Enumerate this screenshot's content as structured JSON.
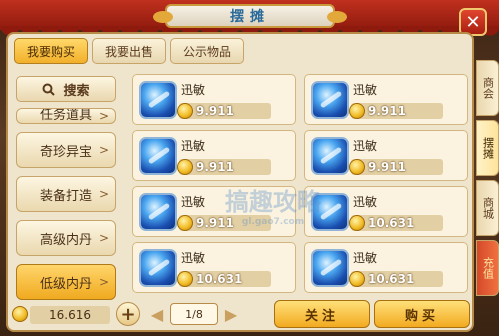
{
  "header": {
    "title": "摆摊",
    "close_label": "✕"
  },
  "tabs": [
    {
      "label": "我要购买",
      "active": true
    },
    {
      "label": "我要出售",
      "active": false
    },
    {
      "label": "公示物品",
      "active": false
    }
  ],
  "search": {
    "label": "搜索"
  },
  "categories": [
    {
      "label": "任务道具",
      "partial": true
    },
    {
      "label": "奇珍异宝"
    },
    {
      "label": "装备打造"
    },
    {
      "label": "高级内丹"
    },
    {
      "label": "低级内丹",
      "active": true
    }
  ],
  "items": [
    {
      "name": "迅敏",
      "price": "9.911"
    },
    {
      "name": "迅敏",
      "price": "9.911"
    },
    {
      "name": "迅敏",
      "price": "9.911"
    },
    {
      "name": "迅敏",
      "price": "9.911"
    },
    {
      "name": "迅敏",
      "price": "9.911"
    },
    {
      "name": "迅敏",
      "price": "10.631"
    },
    {
      "name": "迅敏",
      "price": "10.631"
    },
    {
      "name": "迅敏",
      "price": "10.631"
    }
  ],
  "footer": {
    "money": "16.616",
    "plus_label": "+",
    "page": "1/8",
    "follow_label": "关注",
    "buy_label": "购买"
  },
  "side_tabs": [
    {
      "label": "商会"
    },
    {
      "label": "摆摊",
      "active": true
    },
    {
      "label": "商城"
    },
    {
      "label": "充值",
      "red": true
    }
  ],
  "watermark": {
    "main": "搞趣攻略",
    "sub": "gl.gao7.com"
  },
  "colors": {
    "accent": "#f2b02a",
    "panel": "#efe4cc",
    "gem": "#1a4fb0"
  }
}
